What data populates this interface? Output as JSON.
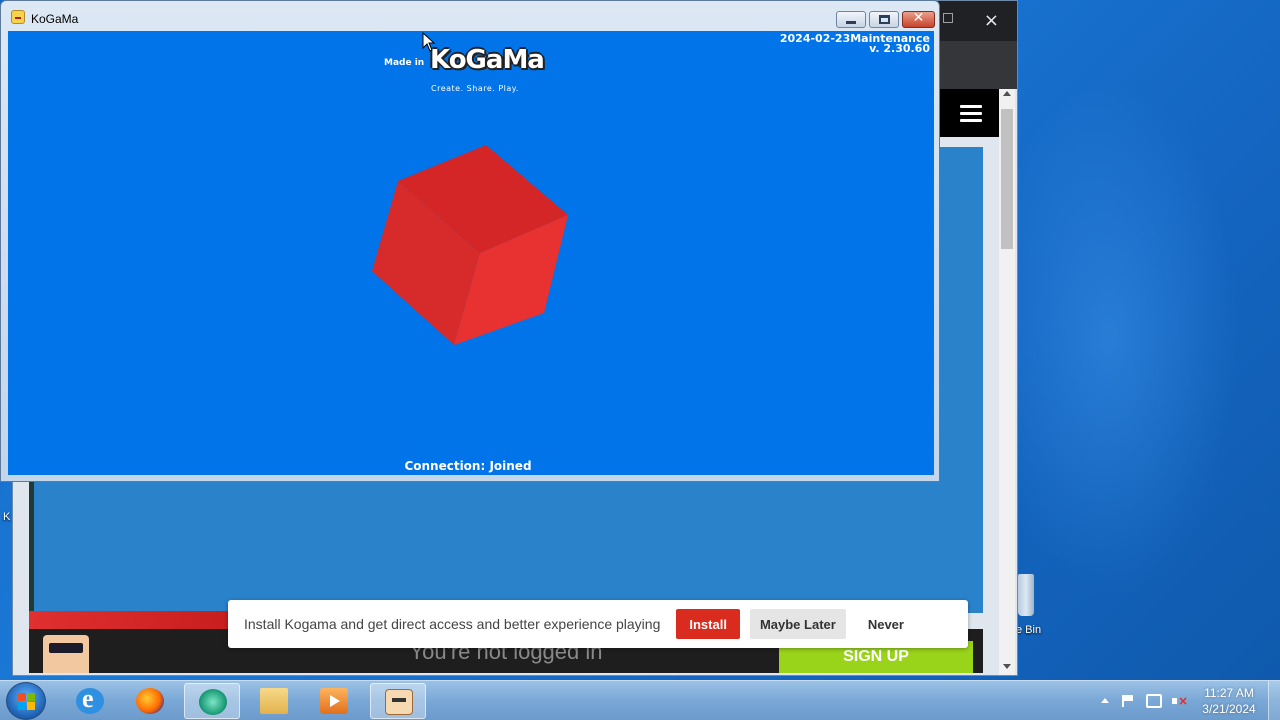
{
  "desktop": {
    "recycle_bin_label": "e Bin",
    "left_edge_label": "K"
  },
  "browser": {
    "title_controls": {
      "close": "×"
    },
    "footer": {
      "not_logged_text": "You're not logged in",
      "signup_label": "SIGN UP"
    }
  },
  "install_banner": {
    "message": "Install Kogama and get direct access and better experience playing",
    "install_label": "Install",
    "later_label": "Maybe Later",
    "never_label": "Never"
  },
  "game_window": {
    "title": "KoGaMa",
    "controls": {
      "close": "✕"
    },
    "made_in": "Made in",
    "logo": "KoGaMa",
    "tagline": "Create. Share. Play.",
    "version_line1": "2024-02-23Maintenance",
    "version_line2": "v. 2.30.60",
    "connection_status": "Connection: Joined",
    "cube_color": "#e02a2a",
    "canvas_color": "#0074e8"
  },
  "taskbar": {
    "items": [
      {
        "name": "internet-explorer",
        "icon": "ie-icon"
      },
      {
        "name": "firefox",
        "icon": "firefox-icon"
      },
      {
        "name": "teal-app",
        "icon": "teal-app-icon"
      },
      {
        "name": "file-explorer",
        "icon": "folder-icon"
      },
      {
        "name": "media-player",
        "icon": "media-icon"
      },
      {
        "name": "kogama",
        "icon": "kogama-icon"
      }
    ],
    "clock_time": "11:27 AM",
    "clock_date": "3/21/2024"
  }
}
